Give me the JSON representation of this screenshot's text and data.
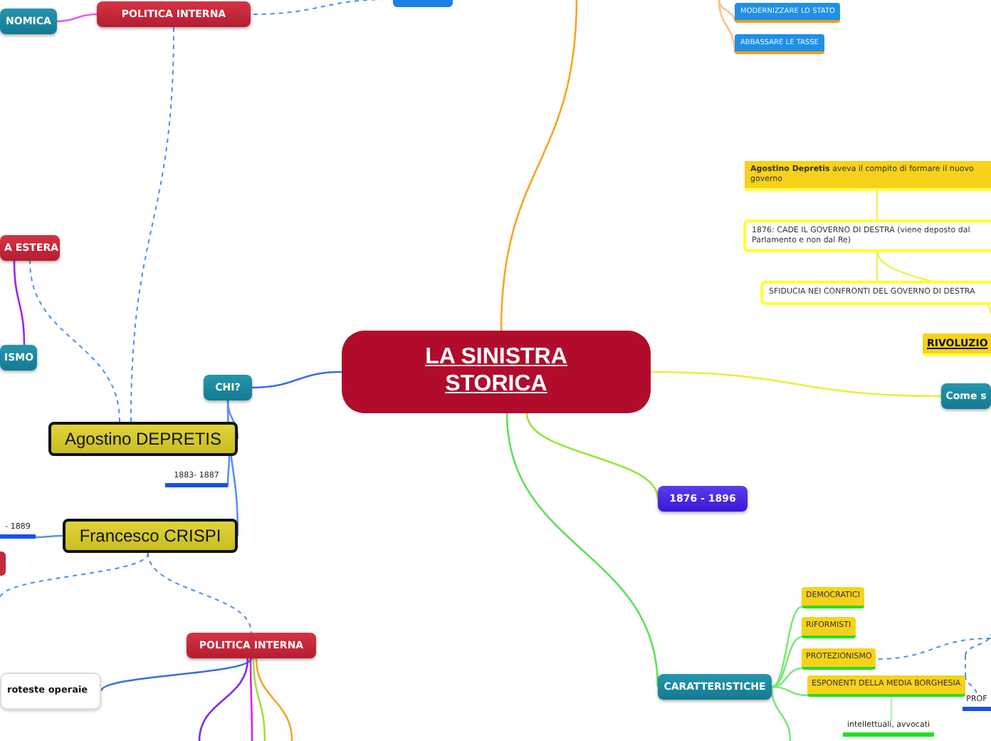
{
  "mind_map": {
    "nodes": [
      {
        "kind": "central",
        "label": "LA SINISTRA STORICA"
      },
      {
        "kind": "red",
        "label": "POLITICA INTERNA"
      },
      {
        "kind": "teal",
        "label": "NOMICA"
      },
      {
        "kind": "blue-stub"
      },
      {
        "kind": "blue-tag",
        "label": "MODERNIZZARE LO STATO"
      },
      {
        "kind": "blue-tag",
        "label": "ABBASSARE LE TASSE"
      },
      {
        "kind": "red",
        "label": "A ESTERA"
      },
      {
        "kind": "teal",
        "label": "ISMO"
      },
      {
        "kind": "teal",
        "label": "CHI?"
      },
      {
        "kind": "person",
        "label": "Agostino DEPRETIS"
      },
      {
        "kind": "date",
        "label": "1883- 1887"
      },
      {
        "kind": "person",
        "label": "Francesco CRISPI"
      },
      {
        "kind": "date",
        "label": "- 1889"
      },
      {
        "kind": "red-stub"
      },
      {
        "kind": "red",
        "label": "POLITICA INTERNA"
      },
      {
        "kind": "white",
        "label": "roteste operaie"
      },
      {
        "kind": "note",
        "label": "**Agostino Depretis** aveva il compito di formare il nuovo governo"
      },
      {
        "kind": "outlined",
        "label": "1876: CADE IL GOVERNO DI DESTRA (viene deposto dal Parlamento e non dal Re)"
      },
      {
        "kind": "outlined",
        "label": "SFIDUCIA NEI CONFRONTI DEL GOVERNO DI DESTRA"
      },
      {
        "kind": "heading",
        "label": "RIVOLUZIO"
      },
      {
        "kind": "teal",
        "label": "Come s"
      },
      {
        "kind": "purple",
        "label": "1876 - 1896"
      },
      {
        "kind": "teal",
        "label": "CARATTERISTICHE"
      },
      {
        "kind": "yellow-tag",
        "label": "DEMOCRATICI"
      },
      {
        "kind": "yellow-tag",
        "label": "RIFORMISTI"
      },
      {
        "kind": "yellow-tag",
        "label": "PROTEZIONISMO"
      },
      {
        "kind": "yellow-tag",
        "label": "ESPONENTI DELLA MEDIA BORGHESIA"
      },
      {
        "kind": "plain",
        "label": "intellettuali, avvocati"
      },
      {
        "kind": "date",
        "label": "PROF"
      }
    ]
  }
}
